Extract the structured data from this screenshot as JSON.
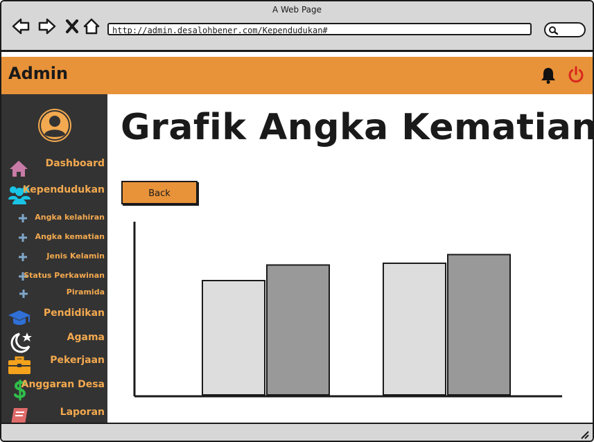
{
  "window": {
    "title": "A Web Page"
  },
  "browser": {
    "url": "http://admin.desalohbener.com/Kependudukan#"
  },
  "header": {
    "brand": "Admin",
    "accent": "#e8933a"
  },
  "sidebar": {
    "items": [
      {
        "label": "Dashboard",
        "icon": "home-icon"
      },
      {
        "label": "Kependudukan",
        "icon": "users-icon"
      },
      {
        "label": "Angka kelahiran",
        "icon": "plus-icon"
      },
      {
        "label": "Angka kematian",
        "icon": "plus-icon"
      },
      {
        "label": "Jenis Kelamin",
        "icon": "plus-icon"
      },
      {
        "label": "Status Perkawinan",
        "icon": "plus-icon"
      },
      {
        "label": "Piramida",
        "icon": "plus-icon"
      },
      {
        "label": "Pendidikan",
        "icon": "graduation-cap-icon"
      },
      {
        "label": "Agama",
        "icon": "moon-star-icon"
      },
      {
        "label": "Pekerjaan",
        "icon": "briefcase-icon"
      },
      {
        "label": "Anggaran Desa",
        "icon": "dollar-icon"
      },
      {
        "label": "Laporan",
        "icon": "book-icon"
      }
    ]
  },
  "main": {
    "title": "Grafik Angka Kematian",
    "back_label": "Back"
  },
  "chart_data": {
    "type": "bar",
    "title": "",
    "xlabel": "",
    "ylabel": "",
    "categories": [
      "",
      ""
    ],
    "series": [
      {
        "values": [
          66,
          76
        ],
        "color": "#dddddd"
      },
      {
        "values": [
          75,
          81
        ],
        "color": "#999999"
      }
    ],
    "ylim": [
      0,
      100
    ],
    "grid": false
  }
}
